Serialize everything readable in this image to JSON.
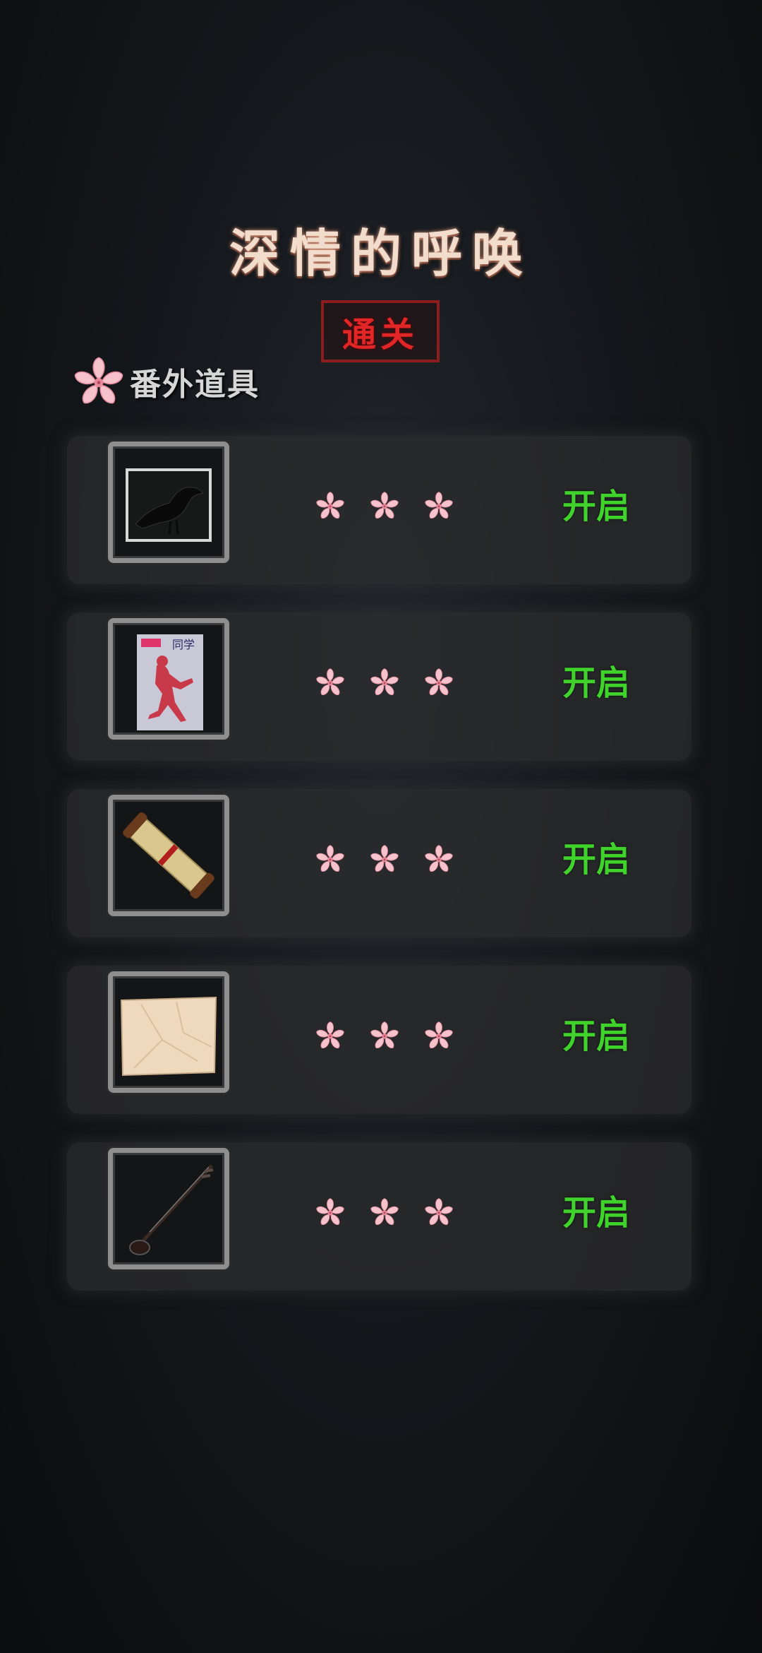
{
  "title": "深情的呼唤",
  "status_badge": "通关",
  "section": {
    "title": "番外道具",
    "icon": "cherry-blossom-icon"
  },
  "items": [
    {
      "name": "crow-photo",
      "icon": "crow-photo-icon",
      "open_label": "开启"
    },
    {
      "name": "magazine",
      "icon": "magazine-icon",
      "magazine_text": "同学",
      "open_label": "开启"
    },
    {
      "name": "scroll",
      "icon": "scroll-icon",
      "open_label": "开启"
    },
    {
      "name": "paper-note",
      "icon": "paper-note-icon",
      "open_label": "开启"
    },
    {
      "name": "erhu",
      "icon": "erhu-icon",
      "open_label": "开启"
    }
  ],
  "colors": {
    "open_text": "#3fd32c",
    "badge_red": "#e02626",
    "blossom_pink": "#f4b6c2"
  }
}
